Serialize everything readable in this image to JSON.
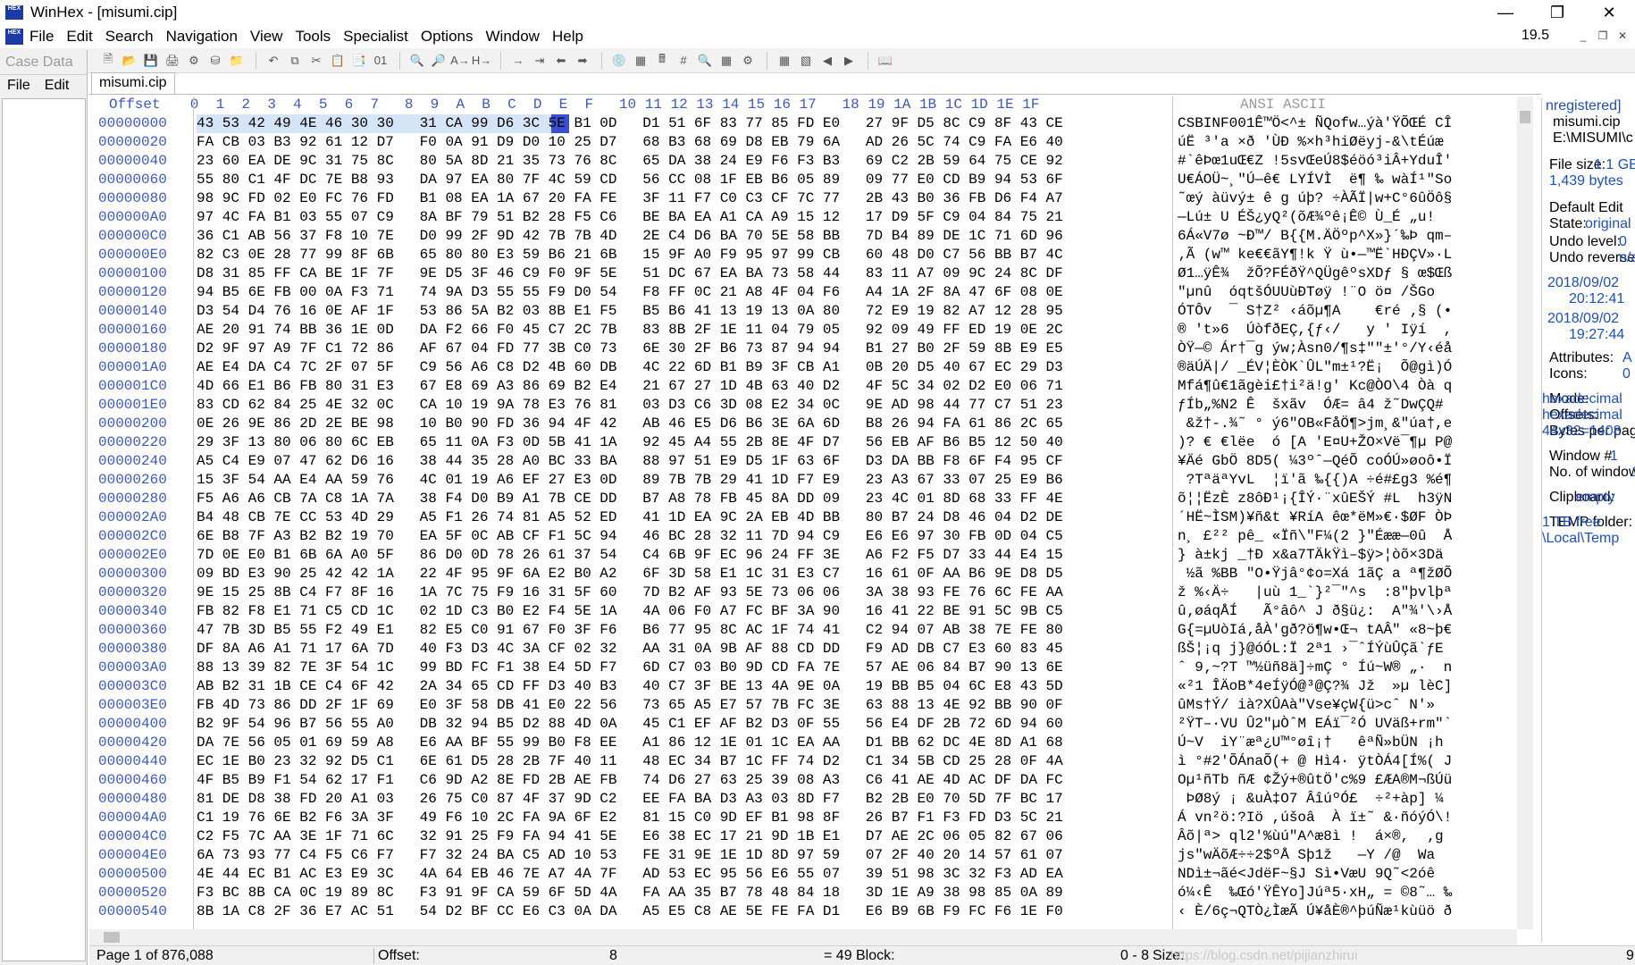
{
  "window": {
    "title": "WinHex - [misumi.cip]",
    "zoom": "19.5"
  },
  "menu": [
    "File",
    "Edit",
    "Search",
    "Navigation",
    "View",
    "Tools",
    "Specialist",
    "Options",
    "Window",
    "Help"
  ],
  "case": {
    "title": "Case Data",
    "menu": [
      "File",
      "Edit"
    ]
  },
  "tab": "misumi.cip",
  "header": {
    "offset": "Offset",
    "columns": "   0  1  2  3  4  5  6  7   8  9  A  B  C  D  E  F   10 11 12 13 14 15 16 17   18 19 1A 1B 1C 1D 1E 1F",
    "ascii": "ANSI ASCII"
  },
  "rows": [
    {
      "off": "00000000",
      "hex": "43 53 42 49 4E 46 30 30 31 CA 99 D6 3C 5E B1 0D D1 51 6F 83 77 85 FD E0 27 9F D5 8C C9 8F 43 CE",
      "asc": "CSBINF001Ê™Ö<^± ÑQofw…ýà'ŸÕŒÉ CÎ"
    },
    {
      "off": "00000020",
      "hex": "FA CB 03 B3 92 61 12 D7 F0 0A 91 D9 D0 10 25 D7 68 B3 68 69 D8 EB 79 6A AD 26 5C 74 C9 FA E6 40",
      "asc": "úË ³'a ×ð 'ÙÐ %×h³hiØëyj-&\\tÉúæ"
    },
    {
      "off": "00000040",
      "hex": "23 60 EA DE 9C 31 75 8C 80 5A 8D 21 35 73 76 8C 65 DA 38 24 E9 F6 F3 B3 69 C2 2B 59 64 75 CE 92",
      "asc": "#`êÞœ1uŒ€Z !5svŒeÚ8$éöó³iÂ+YduÎ'"
    },
    {
      "off": "00000060",
      "hex": "55 80 C1 4F DC 7E B8 93 DA 97 EA 80 7F 4C 59 CD 56 CC 08 1F EB B6 05 89 09 77 E0 CD B9 94 53 6F",
      "asc": "U€ÁOÜ~¸\"Ú—ê€ LYÍVÌ  ë¶ ‰ wàÍ¹\"So"
    },
    {
      "off": "00000080",
      "hex": "98 9C FD 02 E0 FC 76 FD B1 08 EA 1A 67 20 FA FE 3F 11 F7 C0 C3 CF 7C 77 2B 43 B0 36 FB D6 F4 A7",
      "asc": "˜œý àüvý± ê g úþ? ÷ÀÃÏ|w+C°6ûÖô§"
    },
    {
      "off": "000000A0",
      "hex": "97 4C FA B1 03 55 07 C9 8A BF 79 51 B2 28 F5 C6 BE BA EA A1 CA A9 15 12 17 D9 5F C9 04 84 75 21",
      "asc": "—Lú± U ÉŠ¿yQ²(õÆ¾ºê¡Ê© Ù_É „u!"
    },
    {
      "off": "000000C0",
      "hex": "36 C1 AB 56 37 F8 10 7E D0 99 2F 9D 42 7B 7B 4D 2E C4 D6 BA 70 5E 58 BB 7D B4 89 DE 1C 71 6D 96",
      "asc": "6Á«V7ø ~Ð™/ B{{M.ÄÖºp^X»}´‰Þ qm–"
    },
    {
      "off": "000000E0",
      "hex": "82 C3 0E 28 77 99 8F 6B 65 80 80 E3 59 B6 21 6B 15 9F A0 F9 95 97 99 CB 60 48 D0 C7 56 BB B7 4C",
      "asc": "‚Ã (w™ ke€€ãY¶!k Ÿ ù•—™Ë`HÐÇV»·L"
    },
    {
      "off": "00000100",
      "hex": "D8 31 85 FF CA BE 1F 7F 9E D5 3F 46 C9 F0 9F 5E 51 DC 67 EA BA 73 58 44 83 11 A7 09 9C 24 8C DF",
      "asc": "Ø1…ÿÊ¾  žÕ?FÉðŸ^QÜgêºsXDƒ § œ$Œß"
    },
    {
      "off": "00000120",
      "hex": "94 B5 6E FB 00 0A F3 71 74 9A D3 55 55 F9 D0 54 F8 FF 0C 21 A8 4F 04 F6 A4 1A 2F 8A 47 6F 08 0E",
      "asc": "\"µnû  óqtšÓUUùÐTøÿ !¨O ö¤ /ŠGo  "
    },
    {
      "off": "00000140",
      "hex": "D3 54 D4 76 16 0E AF 1F 53 86 5A B2 03 8B E1 F5 B5 B6 41 13 19 13 0A 80 72 E9 19 82 A7 12 28 95",
      "asc": "ÓTÔv  ¯ S†Z² ‹áõµ¶A    €ré ‚§ (•"
    },
    {
      "off": "00000160",
      "hex": "AE 20 91 74 BB 36 1E 0D DA F2 66 F0 45 C7 2C 7B 83 8B 2F 1E 11 04 79 05 92 09 49 FF ED 19 0E 2C",
      "asc": "® 't»6  ÚòfðEÇ,{ƒ‹/   y ' Iÿí  ,"
    },
    {
      "off": "00000180",
      "hex": "D2 9F 97 A9 7F C1 72 86 AF 67 04 FD 77 3B C0 73 6E 30 2F B6 73 87 94 94 B1 27 B0 2F 59 8B E9 E5",
      "asc": "ÒŸ—© Ár†¯g ýw;Àsn0/¶s‡\"\"±'°/Y‹éå"
    },
    {
      "off": "000001A0",
      "hex": "AE E4 DA C4 7C 2F 07 5F C9 56 A6 C8 D2 4B 60 DB 4C 22 6D B1 B9 3F CB A1 0B 20 D5 40 67 EC 29 D3",
      "asc": "®äÚÄ|/ _ÉV¦ÈÒK`ÛL\"m±¹?Ë¡  Õ@gì)Ó"
    },
    {
      "off": "000001C0",
      "hex": "4D 66 E1 B6 FB 80 31 E3 67 E8 69 A3 86 69 B2 E4 21 67 27 1D 4B 63 40 D2 4F 5C 34 02 D2 E0 06 71",
      "asc": "Mfá¶û€1ãgèi£†i²ä!g' Kc@ÒO\\4 Òà q"
    },
    {
      "off": "000001E0",
      "hex": "83 CD 62 84 25 4E 32 0C CA 10 19 9A 78 E3 76 81 03 D3 C6 3D 08 E2 34 0C 9E AD 98 44 77 C7 51 23",
      "asc": "ƒÍb„%N2 Ê  šxãv  ÓÆ= â4 ž­˜DwÇQ#"
    },
    {
      "off": "00000200",
      "hex": "0E 26 9E 86 2D 2E BE 98 10 B0 90 FD 36 94 4F 42 AB 46 E5 D6 B6 3E 6A 6D B8 26 94 FA 61 86 2C 65",
      "asc": " &ž†-.¾˜ ° ý6\"OB«FåÖ¶>jm¸&\"úa†,e"
    },
    {
      "off": "00000220",
      "hex": "29 3F 13 80 06 80 6C EB 65 11 0A F3 0D 5B 41 1A 92 45 A4 55 2B 8E 4F D7 56 EB AF B6 B5 12 50 40",
      "asc": ")? € €lëe  ó [A 'E¤U+ŽO×Vë¯¶µ P@"
    },
    {
      "off": "00000240",
      "hex": "A5 C4 E9 07 47 62 D6 16 38 44 35 28 A0 BC 33 BA 88 97 51 E9 D5 1F 63 6F D3 DA BB F8 6F F4 95 CF",
      "asc": "¥Äé GbÖ 8D5( ¼3ºˆ—QéÕ coÓÚ»øoô•Ï"
    },
    {
      "off": "00000260",
      "hex": "15 3F 54 AA E4 AA 59 76 4C 01 19 A6 EF 27 E3 0D 89 7B 7B 29 41 1D F7 E9 23 A3 67 33 07 25 E9 B6",
      "asc": " ?TªäªYvL  ¦ï'ã ‰{{)A ÷é#£g3 %é¶"
    },
    {
      "off": "00000280",
      "hex": "F5 A6 A6 CB 7A C8 1A 7A 38 F4 D0 B9 A1 7B CE DD B7 A8 78 FB 45 8A DD 09 23 4C 01 8D 68 33 FF 4E",
      "asc": "õ¦¦ËzÈ z8ôÐ¹¡{ÎÝ·¨xûEŠÝ #L  h3ÿN"
    },
    {
      "off": "000002A0",
      "hex": "B4 48 CB 7E CC 53 4D 29 A5 F1 26 74 81 A5 52 ED 41 1D EA 9C 2A EB 4D BB 80 B7 24 D8 46 04 D2 DE",
      "asc": "´HË~ÌSM)¥ñ&t ¥RíA êœ*ëM»€·$ØF ÒÞ"
    },
    {
      "off": "000002C0",
      "hex": "6E B8 7F A3 B2 B2 19 70 EA 5F 0C AB CF F1 5C 94 46 BC 28 32 11 7D 94 C9 E6 E6 97 30 FB 0D 04 C5",
      "asc": "n¸ £²² pê_ «Ïñ\\\"F¼(2 }\"Éææ—0û  Å"
    },
    {
      "off": "000002E0",
      "hex": "7D 0E E0 B1 6B 6A A0 5F 86 D0 0D 78 26 61 37 54 C4 6B 9F EC 96 24 FF 3E A6 F2 F5 D7 33 44 E4 15",
      "asc": "} à±kj _†Ð x&a7TÄkŸì–$ÿ>¦òõ×3Dä "
    },
    {
      "off": "00000300",
      "hex": "09 BD E3 90 25 42 42 1A 22 4F 95 9F 6A E2 B0 A2 6F 3D 58 E1 1C 31 E3 C7 16 61 0F AA B6 9E D8 D5",
      "asc": " ½ã %BB \"O•Ÿjâ°¢o=Xá 1ãÇ a ª¶žØÕ"
    },
    {
      "off": "00000320",
      "hex": "9E 15 25 8B C4 F7 8F 16 1A 7C 75 F9 16 31 5F 60 7D B2 AF 93 5E 73 06 06 3A 38 93 FE 76 6C FE AA",
      "asc": "ž %‹Ä÷   |uù 1_`}²¯\"^s  :8\"þvlþª"
    },
    {
      "off": "00000340",
      "hex": "FB 82 F8 E1 71 C5 CD 1C 02 1D C3 B0 E2 F4 5E 1A 4A 06 F0 A7 FC BF 3A 90 16 41 22 BE 91 5C 9B C5",
      "asc": "û‚øáqÅÍ   Ã°âô^ J ð§ü¿:  A\"¾'\\›Å"
    },
    {
      "off": "00000360",
      "hex": "47 7B 3D B5 55 F2 49 E1 82 E5 C0 91 67 F0 3F F6 B6 77 95 8C AC 1F 74 41 C2 94 07 AB 38 7E FE 80",
      "asc": "G{=µUòIá‚åÀ'gð?ö¶w•Œ¬ tAÂ\" «8~þ€"
    },
    {
      "off": "00000380",
      "hex": "DF 8A A6 A1 71 17 6A 7D 40 F3 D3 4C 3A CF 02 32 AA 31 0A 9B AF 88 CD DD F9 AD DB C7 E3 60 83 45",
      "asc": "ßŠ¦¡q j}@óÓL:Ï 2ª1 ›¯ˆÍÝù­ÛÇã`ƒE"
    },
    {
      "off": "000003A0",
      "hex": "88 13 39 82 7E 3F 54 1C 99 BD FC F1 38 E4 5D F7 6D C7 03 B0 9D CD FA 7E 57 AE 06 84 B7 90 13 6E",
      "asc": "ˆ 9‚~?T ™½üñ8ä]÷mÇ ° Íú~W® „·  n"
    },
    {
      "off": "000003C0",
      "hex": "AB B2 31 1B CE C4 6F 42 2A 34 65 CD FF D3 40 B3 40 C7 3F BE 13 4A 9E 0A 19 BB B5 04 6C E8 43 5D",
      "asc": "«²1 ÎÄoB*4eÍÿÓ@³@Ç?¾ Jž  »µ lèC]"
    },
    {
      "off": "000003E0",
      "hex": "FB 4D 73 86 DD 2F 1F 69 E0 3F 58 DB 41 E0 22 56 73 65 A5 E7 57 7B FC 3E 63 88 13 4E 92 BB 90 0F",
      "asc": "ûMs†Ý/ ià?XÛAà\"Vse¥çW{ü>cˆ N'» "
    },
    {
      "off": "00000400",
      "hex": "B2 9F 54 96 B7 56 55 A0 DB 32 94 B5 D2 88 4D 0A 45 C1 EF AF B2 D3 0F 55 56 E4 DF 2B 72 6D 94 60",
      "asc": "²ŸT–·VU Û2\"µÒˆM EÁï¯²Ó UVäß+rm\"`"
    },
    {
      "off": "00000420",
      "hex": "DA 7E 56 05 01 69 59 A8 E6 AA BF 55 99 B0 F8 EE A1 86 12 1E 01 1C EA AA D1 BB 62 DC 4E 8D A1 68",
      "asc": "Ú~V  iY¨æª¿U™°øî¡†   êªÑ»bÜN ¡h"
    },
    {
      "off": "00000440",
      "hex": "EC 1E B0 23 32 92 D5 C1 6E 61 D5 28 2B 7F 40 11 48 EC 34 B7 1C FF 74 D2 C1 34 5B CD 25 28 0F 4A",
      "asc": "ì °#2'ÕÁnaÕ(+ @ Hì4· ÿtÒÁ4[Í%( J"
    },
    {
      "off": "00000460",
      "hex": "4F B5 B9 F1 54 62 17 F1 C6 9D A2 8E FD 2B AE FB 74 D6 27 63 25 39 08 A3 C6 41 AE 4D AC DF DA FC",
      "asc": "Oµ¹ñTb ñÆ ¢Žý+®ûtÖ'c%9 £ÆA®M¬ßÚü"
    },
    {
      "off": "00000480",
      "hex": "81 DE D8 38 FD 20 A1 03 26 75 C0 87 4F 37 9D C2 EE FA BA D3 A3 03 8D F7 B2 2B E0 70 5D 7F BC 17",
      "asc": " ÞØ8ý ¡ &uÀ‡O7 ÂîúºÓ£  ÷²+àp] ¼ "
    },
    {
      "off": "000004A0",
      "hex": "C1 19 76 6E B2 F6 3A 3F 49 F6 10 2C FA 9A 6F E2 81 15 C0 9D EF B1 98 8F 26 B7 F1 F3 FD D3 5C 21",
      "asc": "Á vn²ö:?Iö ,úšoâ  À ï±˜ &·ñóýÓ\\!"
    },
    {
      "off": "000004C0",
      "hex": "C2 F5 7C AA 3E 1F 71 6C 32 91 25 F9 FA 94 41 5E E6 38 EC 17 21 9D 1B E1 D7 AE 2C 06 05 82 67 06",
      "asc": "Âõ|ª> ql2'%ùú\"A^æ8ì !  á×®,  ‚g "
    },
    {
      "off": "000004E0",
      "hex": "6A 73 93 77 C4 F5 C6 F7 F7 32 24 BA C5 AD 10 53 FE 31 9E 1E 1D 8D 97 59 07 2F 40 20 14 57 61 07",
      "asc": "js\"wÄõÆ÷÷2$ºÅ­ Sþ1ž   —Y /@  Wa "
    },
    {
      "off": "00000500",
      "hex": "4E 44 EC B1 AC E3 E9 3C 4A 64 EB 46 7E A7 4A 7F AD 53 EC 95 56 E6 55 07 39 51 98 3C 32 F3 AD EA",
      "asc": "NDì±¬ãé<JdëF~§J ­Sì•VæU 9Q˜<2ó­ê"
    },
    {
      "off": "00000520",
      "hex": "F3 BC 8B CA 0C 19 89 8C F3 91 9F CA 59 6F 5D 4A FA AA 35 B7 78 48 84 18 3D 1E A9 38 98 85 0A 89",
      "asc": "ó¼‹Ê  ‰Œó'ŸÊYo]Júª5·xH„ = ©8˜… ‰"
    },
    {
      "off": "00000540",
      "hex": "8B 1A C8 2F 36 E7 AC 51 54 D2 BF CC E6 C3 0A DA A5 E5 C8 AE 5E FE FA D1 E6 B9 6B F9 FC F6 1E F0",
      "asc": "‹ È/6ç¬QTÒ¿ÌæÃ Ú¥åÈ®^þúÑæ¹kùüö ð"
    }
  ],
  "status": {
    "page": "Page 1 of 876,088",
    "offset_label": "Offset:",
    "offset_value": "8",
    "eq": "= 49",
    "block_label": "Block:",
    "block_value": "0 - 8",
    "size_label": "Size:",
    "size_value": "9"
  },
  "info": {
    "reg": "nregistered]",
    "file": "misumi.cip",
    "path": "E:\\MISUMI\\c",
    "size_label": "File size:",
    "size_val": "1.1 GB",
    "bytes": "1,439 bytes",
    "edit_mode1": "Default Edit",
    "edit_mode2": "State:",
    "edit_orig": "original",
    "undo1": "Undo level:",
    "undo1v": "0",
    "undo2": "Undo reverse:",
    "undo2v": "n/a",
    "created": "2018/09/02",
    "created_t": "20:12:41",
    "modified": "2018/09/02",
    "modified_t": "19:27:44",
    "attr": "Attributes:",
    "attr_v": "A",
    "icons": "Icons:",
    "icons_v": "0",
    "mode": "Mode:",
    "mode_v": "hexadecimal",
    "offsets": "Offsets:",
    "offsets_v": "hexadecimal",
    "bpp": "Bytes per page:",
    "bpp_v": "44x32=1408",
    "win": "Window #",
    "win_v": "1",
    "nwin": "No. of windows:",
    "nwin_v": "1",
    "clip": "Clipboard:",
    "clip_v": "empty",
    "temp": "TEMP folder:",
    "temp_v": "1 TB free",
    "temp_path": "\\Local\\Temp"
  },
  "watermark": "https://blog.csdn.net/pijianzhirui"
}
